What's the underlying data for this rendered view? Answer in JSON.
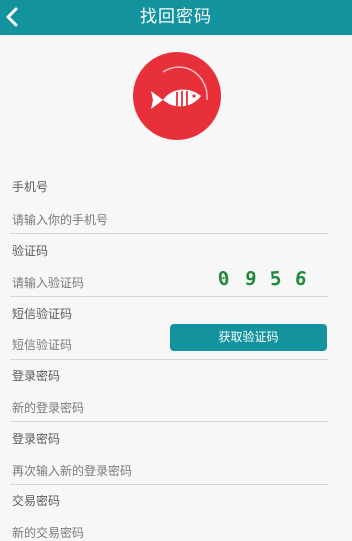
{
  "header": {
    "title": "找回密码"
  },
  "form": {
    "phone": {
      "label": "手机号",
      "placeholder": "请输入你的手机号"
    },
    "captcha": {
      "label": "验证码",
      "placeholder": "请输入验证码",
      "code": [
        "0",
        "9",
        "5",
        "6"
      ]
    },
    "sms": {
      "label": "短信验证码",
      "placeholder": "短信验证码",
      "button_label": "获取验证码"
    },
    "login_password": {
      "label": "登录密码",
      "placeholder": "新的登录密码"
    },
    "login_password_confirm": {
      "label": "登录密码",
      "placeholder": "再次输入新的登录密码"
    },
    "trade_password": {
      "label": "交易密码",
      "placeholder": "新的交易密码"
    }
  },
  "colors": {
    "header_bg": "#13939e",
    "logo_bg": "#e8303b",
    "button_bg": "#13939e",
    "captcha_text": "#1f8a3b"
  },
  "icons": {
    "back": "chevron-left-icon",
    "logo": "fish-logo-icon"
  }
}
